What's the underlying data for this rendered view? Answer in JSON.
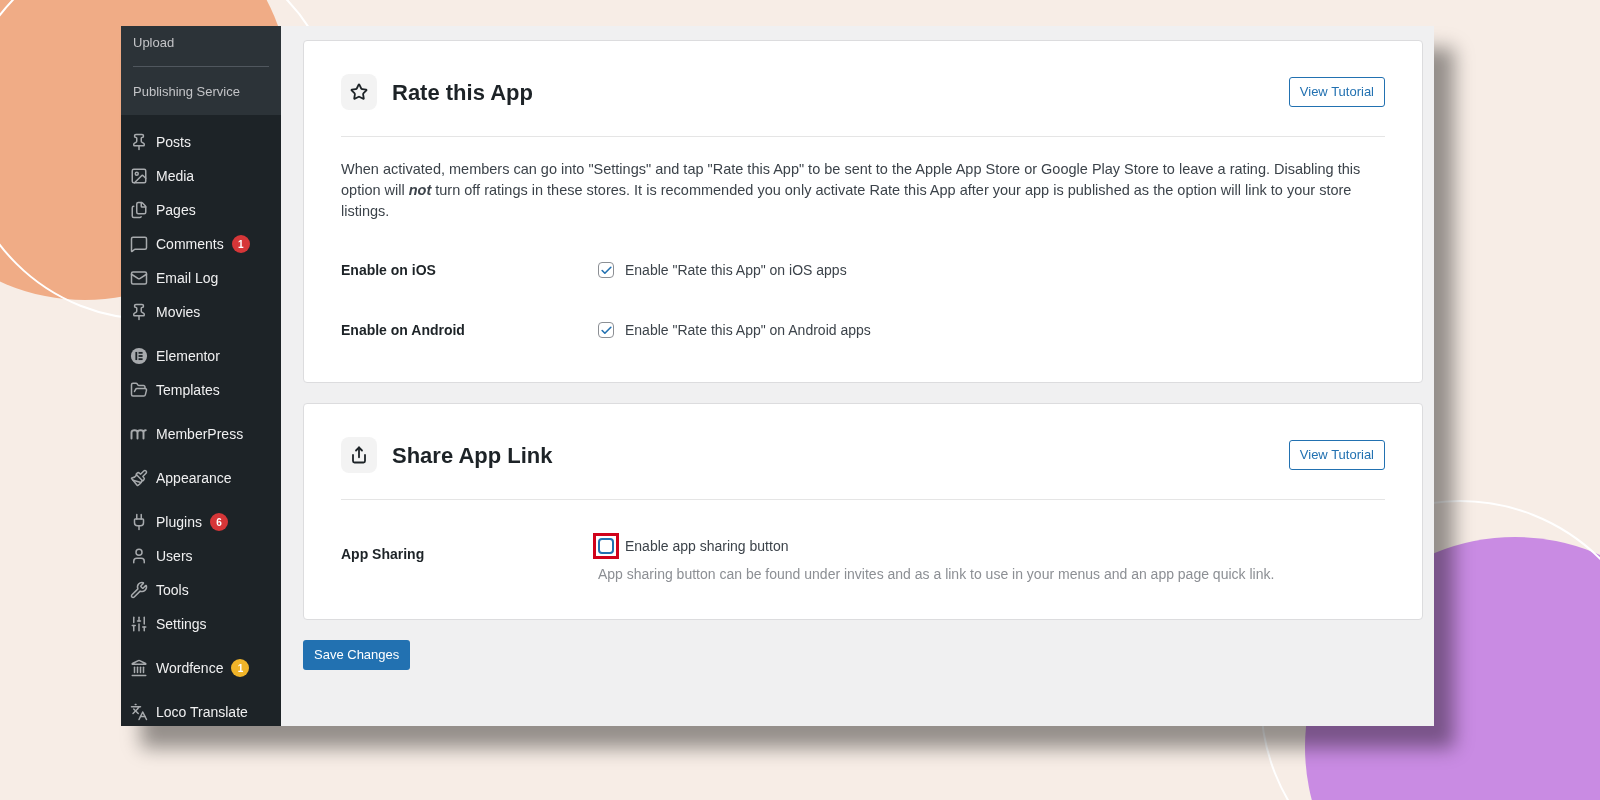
{
  "sidebar": {
    "submenu": [
      {
        "label": "Upload"
      },
      {
        "label": "Publishing Service"
      }
    ],
    "groups": [
      [
        {
          "label": "Posts"
        },
        {
          "label": "Media"
        },
        {
          "label": "Pages"
        },
        {
          "label": "Comments",
          "badge": "1",
          "color": "#d63638"
        },
        {
          "label": "Email Log"
        },
        {
          "label": "Movies"
        }
      ],
      [
        {
          "label": "Elementor"
        },
        {
          "label": "Templates"
        }
      ],
      [
        {
          "label": "MemberPress"
        }
      ],
      [
        {
          "label": "Appearance"
        }
      ],
      [
        {
          "label": "Plugins",
          "badge": "6",
          "color": "#d63638"
        },
        {
          "label": "Users"
        },
        {
          "label": "Tools"
        },
        {
          "label": "Settings"
        }
      ],
      [
        {
          "label": "Wordfence",
          "badge": "1",
          "color": "#f0b429"
        }
      ],
      [
        {
          "label": "Loco Translate"
        }
      ]
    ]
  },
  "cards": [
    {
      "title": "Rate this App",
      "button": "View Tutorial",
      "description": "When activated, members can go into \"Settings\" and tap \"Rate this App\" to be sent to the Apple App Store or Google Play Store to leave a rating. Disabling this option will *not* turn off ratings in these stores. It is recommended you only activate Rate this App after your app is published as the option will link to your store listings.",
      "options": [
        {
          "label": "Enable on iOS",
          "checkbox": "Enable \"Rate this App\" on iOS apps",
          "checked": true,
          "highlighted": false
        },
        {
          "label": "Enable on Android",
          "checkbox": "Enable \"Rate this App\" on Android apps",
          "checked": true,
          "highlighted": false
        }
      ]
    },
    {
      "title": "Share App Link",
      "button": "View Tutorial",
      "options": [
        {
          "label": "App Sharing",
          "checkbox": "Enable app sharing button",
          "checked": false,
          "highlighted": true,
          "help": "App sharing button can be found under invites and as a link to use in your menus and an app page quick link."
        }
      ]
    }
  ],
  "save_button": "Save Changes"
}
